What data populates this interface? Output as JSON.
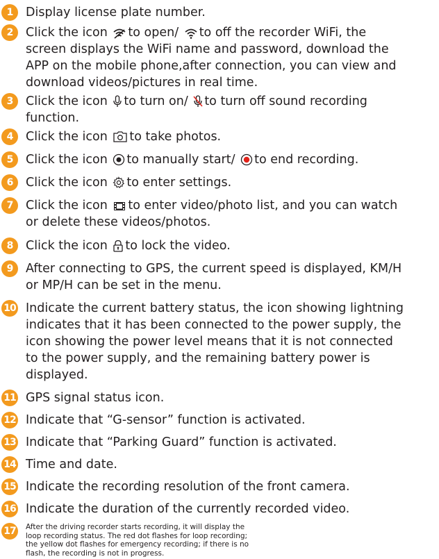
{
  "colors": {
    "badge": "#f39a1e",
    "text": "#231f20",
    "record_red": "#e2231a"
  },
  "items": [
    {
      "num": "1",
      "lines": [
        "Display license plate number."
      ]
    },
    {
      "num": "2",
      "lines": [
        "Click the icon",
        "to open/",
        "to off the recorder WiFi, the",
        "screen displays the WiFi name and password, download the",
        "APP on the mobile phone,after connection, you can view and",
        "download videos/pictures in real time."
      ]
    },
    {
      "num": "3",
      "lines": [
        "Click the icon",
        "to turn on/",
        "to turn off sound recording",
        "function."
      ]
    },
    {
      "num": "4",
      "lines": [
        "Click the icon",
        "to take photos."
      ]
    },
    {
      "num": "5",
      "lines": [
        "Click the icon",
        "to manually start/",
        "to end recording."
      ]
    },
    {
      "num": "6",
      "lines": [
        "Click the icon",
        "to enter settings."
      ]
    },
    {
      "num": "7",
      "lines": [
        "Click the icon",
        "to enter video/photo list, and you can watch",
        "or delete these videos/photos."
      ]
    },
    {
      "num": "8",
      "lines": [
        "Click the icon",
        "to lock the video."
      ]
    },
    {
      "num": "9",
      "lines": [
        "After connecting to GPS, the current speed is displayed, KM/H",
        "or MP/H can be set in the menu."
      ]
    },
    {
      "num": "10",
      "lines": [
        "Indicate the current battery status, the icon showing lightning",
        "indicates that it has been connected to the power supply, the",
        "icon showing the power level means that it is not connected",
        "to the power supply, and the remaining battery power is",
        "displayed."
      ]
    },
    {
      "num": "11",
      "lines": [
        "GPS signal status icon."
      ]
    },
    {
      "num": "12",
      "lines": [
        "Indicate that “G-sensor” function is activated."
      ]
    },
    {
      "num": "13",
      "lines": [
        "Indicate that “Parking Guard” function is activated."
      ]
    },
    {
      "num": "14",
      "lines": [
        "Time and date."
      ]
    },
    {
      "num": "15",
      "lines": [
        "Indicate the recording resolution of the front camera."
      ]
    },
    {
      "num": "16",
      "lines": [
        "Indicate the duration of the currently recorded video."
      ]
    },
    {
      "num": "17",
      "lines": [
        "After the driving recorder starts recording, it will display the",
        "loop recording status. The red dot flashes for loop recording;",
        "the yellow dot flashes for emergency recording; if there is no",
        "flash, the recording is not in progress."
      ]
    }
  ]
}
